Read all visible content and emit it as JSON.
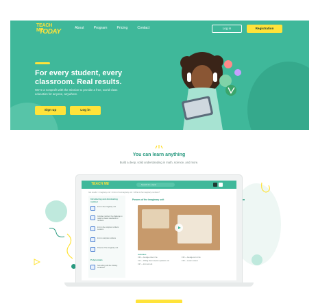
{
  "nav": {
    "logo_top": "TEACH ME",
    "logo_bottom": "TODAY",
    "links": [
      "About",
      "Program",
      "Pricing",
      "Contact"
    ],
    "login_label": "Log in",
    "register_label": "Registration"
  },
  "hero": {
    "title": "For every student, every classroom. Real results.",
    "subtitle": "We're a nonprofit with the mission to provide a free, world-class education for anyone, anywhere.",
    "signup_label": "Sign up",
    "login_label": "Log in"
  },
  "section": {
    "title": "You can learn anything",
    "subtitle": "Build a deep, solid understanding in math, science, and more."
  },
  "app": {
    "logo": "TEACH ME",
    "search_placeholder": "Search for a topic",
    "breadcrumb": "Get results  >  Imaginary unit  >  Intro to the imaginary unit  >  What is the imaginary numbers?",
    "sidebar_heading": "Introducing and dominating number",
    "sidebar_items": [
      "Intro to the imaginary unit",
      "Complex number: the challenge to relate to classic standards to numbers",
      "Intro to the complex numbers: Lessons",
      "Intro to complex numbers",
      "Powers of the imaginary unit"
    ],
    "sidebar_heading_2": "Polynomials",
    "sidebar_item_last": "Something with the thinking worksheet",
    "main_title": "Powers of the imaginary unit",
    "activities_heading": "Activities",
    "activities": [
      "0:00 — Average voice in the",
      "0:12 — Writing about complex equations unit",
      "0:27 — Intro sub unit",
      "0:32 — Average sum in the",
      "0:48 — Lesson content"
    ]
  },
  "colors": {
    "brand_green": "#3fb89a",
    "accent_yellow": "#ffe33a",
    "heading_green": "#2a9a80"
  }
}
